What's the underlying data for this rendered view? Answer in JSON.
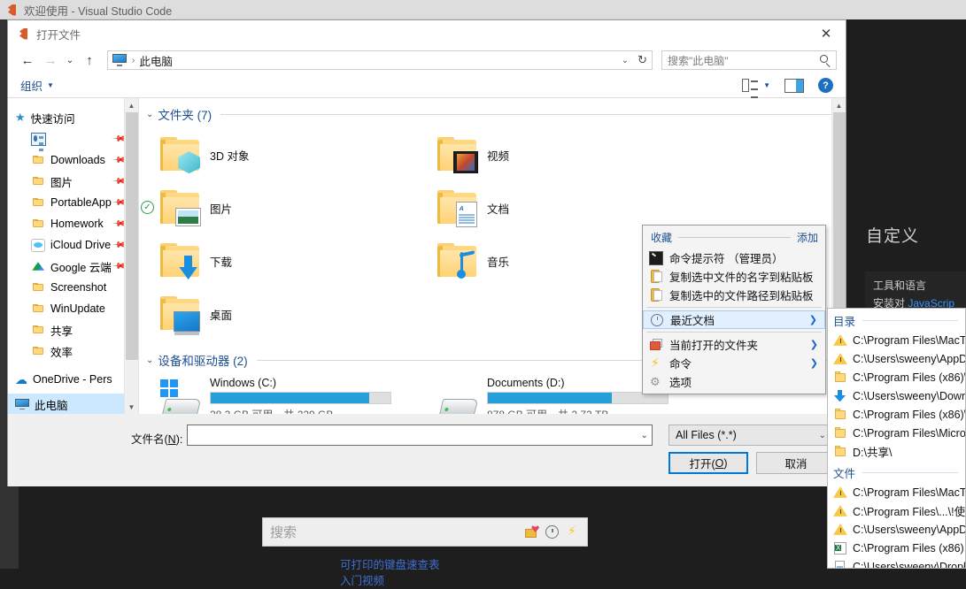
{
  "vscode": {
    "window_title": "欢迎使用 - Visual Studio Code",
    "custom_heading": "自定义",
    "card_title": "工具和语言",
    "card_sub_prefix": "安装对 ",
    "card_sub_link": "JavaScrip",
    "search_placeholder": "搜索",
    "ghost_text": "",
    "links": [
      "可打印的键盘速查表",
      "入门视频"
    ],
    "icons": [
      "favorites-folder-icon",
      "recent-clock-icon",
      "command-bolt-icon"
    ]
  },
  "dialog": {
    "title": "打开文件",
    "close_label": "✕",
    "nav": {
      "back": "←",
      "forward": "→",
      "recent": "⌄",
      "up": "↑",
      "address_value": "此电脑",
      "address_sep": "›",
      "dropdown": "⌄",
      "refresh": "↻",
      "search_placeholder": "搜索\"此电脑\""
    },
    "commandbar": {
      "organize": "组织",
      "caret": "▼",
      "view_icon": "view-layout-icon",
      "view_caret": "▼",
      "pane_icon": "preview-pane-icon",
      "help_icon": "help-icon",
      "help_label": "?"
    },
    "navpane": {
      "quick_access": "快速访问",
      "items": [
        {
          "label": "",
          "icon": "contacts-icon",
          "pinned": true
        },
        {
          "label": "Downloads",
          "icon": "folder-icon",
          "pinned": true
        },
        {
          "label": "图片",
          "icon": "folder-icon",
          "pinned": true
        },
        {
          "label": "PortableApp",
          "icon": "folder-icon",
          "pinned": true
        },
        {
          "label": "Homework",
          "icon": "folder-icon",
          "pinned": true
        },
        {
          "label": "iCloud Drive",
          "icon": "icloud-icon",
          "pinned": true
        },
        {
          "label": "Google 云端",
          "icon": "google-drive-icon",
          "pinned": true
        },
        {
          "label": "Screenshot",
          "icon": "folder-icon",
          "pinned": false
        },
        {
          "label": "WinUpdate",
          "icon": "folder-icon",
          "pinned": false
        },
        {
          "label": "共享",
          "icon": "folder-icon",
          "pinned": false
        },
        {
          "label": "效率",
          "icon": "folder-icon",
          "pinned": false
        }
      ],
      "onedrive": "OneDrive - Pers",
      "thispc": "此电脑"
    },
    "groups": {
      "folders_title": "文件夹 (7)",
      "devices_title": "设备和驱动器 (2)"
    },
    "folders": [
      {
        "label": "3D 对象",
        "icon": "3d-objects-folder-icon",
        "checked": false
      },
      {
        "label": "视频",
        "icon": "videos-folder-icon",
        "checked": false
      },
      {
        "label": "图片",
        "icon": "pictures-folder-icon",
        "checked": true
      },
      {
        "label": "文档",
        "icon": "documents-folder-icon",
        "checked": false
      },
      {
        "label": "下载",
        "icon": "downloads-folder-icon",
        "checked": false
      },
      {
        "label": "音乐",
        "icon": "music-folder-icon",
        "checked": false
      },
      {
        "label": "桌面",
        "icon": "desktop-folder-icon",
        "checked": false
      }
    ],
    "drives": [
      {
        "name": "Windows (C:)",
        "sub": "28.3 GB 可用，共 229 GB",
        "used_pct": 88,
        "icon": "windows-drive-icon"
      },
      {
        "name": "Documents (D:)",
        "sub": "878 GB 可用，共 2.72 TB",
        "used_pct": 69,
        "icon": "hdd-icon"
      }
    ],
    "footer": {
      "filename_label_pre": "文件名(",
      "filename_label_key": "N",
      "filename_label_post": "):",
      "filename_value": "",
      "filter_value": "All Files (*.*)",
      "open_pre": "打开(",
      "open_key": "O",
      "open_post": ")",
      "cancel": "取消"
    }
  },
  "fav_menu": {
    "header_left": "收藏",
    "header_right": "添加",
    "items": [
      {
        "label": "命令提示符 （管理员）",
        "icon": "command-prompt-icon",
        "arrow": "",
        "highlight": false
      },
      {
        "label": "复制选中文件的名字到粘贴板",
        "icon": "clipboard-icon",
        "arrow": "",
        "highlight": false
      },
      {
        "label": "复制选中的文件路径到粘贴板",
        "icon": "clipboard-icon",
        "arrow": "",
        "highlight": false
      },
      {
        "label": "最近文档",
        "icon": "clock-icon",
        "arrow": "❯",
        "highlight": true
      },
      {
        "label": "当前打开的文件夹",
        "icon": "open-folders-icon",
        "arrow": "❯",
        "highlight": false
      },
      {
        "label": "命令",
        "icon": "bolt-icon",
        "arrow": "❯",
        "highlight": false
      },
      {
        "label": "选项",
        "icon": "gear-icon",
        "arrow": "",
        "highlight": false
      }
    ]
  },
  "right_panel": {
    "dir_header": "目录",
    "dirs": [
      {
        "path": "C:\\Program Files\\MacT",
        "icon": "warning-icon"
      },
      {
        "path": "C:\\Users\\sweeny\\AppDa",
        "icon": "warning-icon"
      },
      {
        "path": "C:\\Program Files (x86)\\",
        "icon": "folder-icon"
      },
      {
        "path": "C:\\Users\\sweeny\\Downl",
        "icon": "downloads-icon"
      },
      {
        "path": "C:\\Program Files (x86)\\",
        "icon": "folder-icon"
      },
      {
        "path": "C:\\Program Files\\Micro",
        "icon": "folder-icon"
      },
      {
        "path": "D:\\共享\\",
        "icon": "folder-icon"
      }
    ],
    "file_header": "文件",
    "files": [
      {
        "path": "C:\\Program Files\\MacT",
        "icon": "warning-icon"
      },
      {
        "path": "C:\\Program Files\\...\\!使",
        "icon": "warning-icon"
      },
      {
        "path": "C:\\Users\\sweeny\\AppDa",
        "icon": "warning-icon"
      },
      {
        "path": "C:\\Program Files (x86).",
        "icon": "excel-icon"
      },
      {
        "path": "C:\\Users\\sweeny\\Dropb",
        "icon": "file-icon"
      }
    ]
  }
}
